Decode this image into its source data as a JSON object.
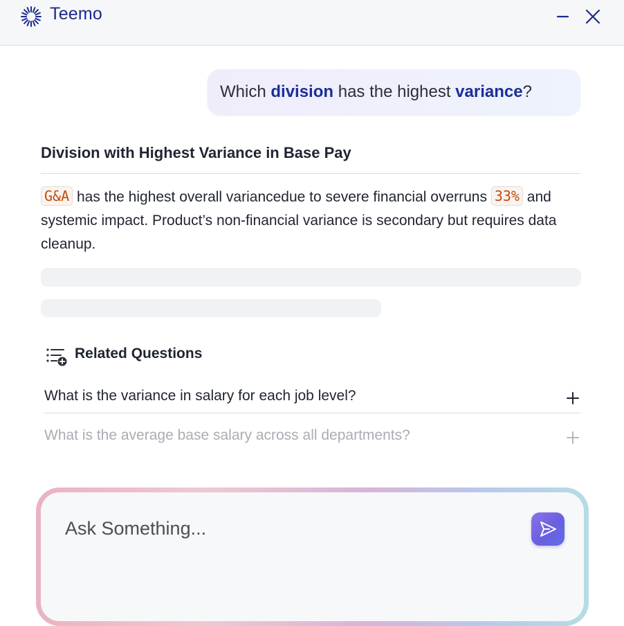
{
  "app": {
    "title": "Teemo",
    "logo_icon": "sunburst-icon"
  },
  "header": {
    "minimize_icon": "minimize-icon",
    "close_icon": "close-icon"
  },
  "user_message": {
    "prefix": "Which ",
    "keyword1": "division",
    "middle": " has the highest ",
    "keyword2": "variance",
    "suffix": "?"
  },
  "answer": {
    "title": "Division with Highest Variance in Base Pay",
    "chip1": "G&A",
    "text1": " has the highest overall variancedue to severe financial overruns ",
    "chip2": "33%",
    "text2": " and systemic impact. Product’s non-financial variance is secondary but requires data cleanup."
  },
  "related": {
    "title": "Related Questions",
    "questions": [
      {
        "text": "What is the variance in salary for each job level?"
      },
      {
        "text": "What is the average base salary across all departments?"
      }
    ]
  },
  "ask": {
    "placeholder": "Ask Something...",
    "send_icon": "send-icon"
  },
  "colors": {
    "brand": "#1c2a8a",
    "keyword": "#1c2f96",
    "chip_text": "#c04c0f",
    "send_button": "#6a5fe0"
  }
}
